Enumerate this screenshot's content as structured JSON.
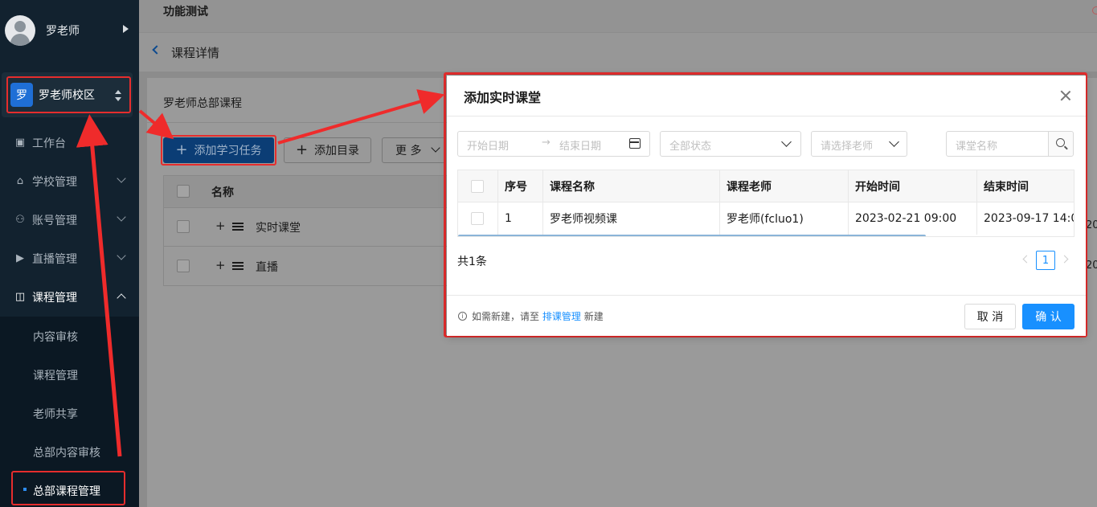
{
  "sidebar": {
    "user_name": "罗老师",
    "campus_badge": "罗",
    "campus_name": "罗老师校区",
    "nav": [
      {
        "label": "工作台",
        "icon": "dashboard-icon"
      },
      {
        "label": "学校管理",
        "icon": "school-icon"
      },
      {
        "label": "账号管理",
        "icon": "users-icon"
      },
      {
        "label": "直播管理",
        "icon": "live-icon"
      },
      {
        "label": "课程管理",
        "icon": "book-icon"
      }
    ],
    "sub": [
      "内容审核",
      "课程管理",
      "老师共享",
      "总部内容审核",
      "总部课程管理"
    ]
  },
  "topbar": {
    "title": "功能测试"
  },
  "breadcrumb": {
    "title": "课程详情"
  },
  "card": {
    "title": "罗老师总部课程",
    "add_task": "添加学习任务",
    "add_dir": "添加目录",
    "more": "更 多",
    "table": {
      "header": "名称",
      "rows": [
        "实时课堂",
        "直播"
      ]
    },
    "peek": [
      "20",
      "20"
    ]
  },
  "modal": {
    "title": "添加实时课堂",
    "start_ph": "开始日期",
    "end_ph": "结束日期",
    "status_ph": "全部状态",
    "teacher_ph": "请选择老师",
    "search_ph": "课堂名称",
    "columns": [
      "序号",
      "课程名称",
      "课程老师",
      "开始时间",
      "结束时间"
    ],
    "rows": [
      {
        "index": "1",
        "name": "罗老师视频课",
        "teacher": "罗老师(fcluo1)",
        "start": "2023-02-21 09:00",
        "end": "2023-09-17 14:0"
      }
    ],
    "total": "共1条",
    "page": "1",
    "tip_prefix": "如需新建，请至",
    "tip_link": "排课管理",
    "tip_suffix": "新建",
    "cancel": "取 消",
    "ok": "确 认"
  },
  "colors": {
    "accent": "#1890ff",
    "highlight": "#e52d2d",
    "sidebar": "#12222f"
  }
}
